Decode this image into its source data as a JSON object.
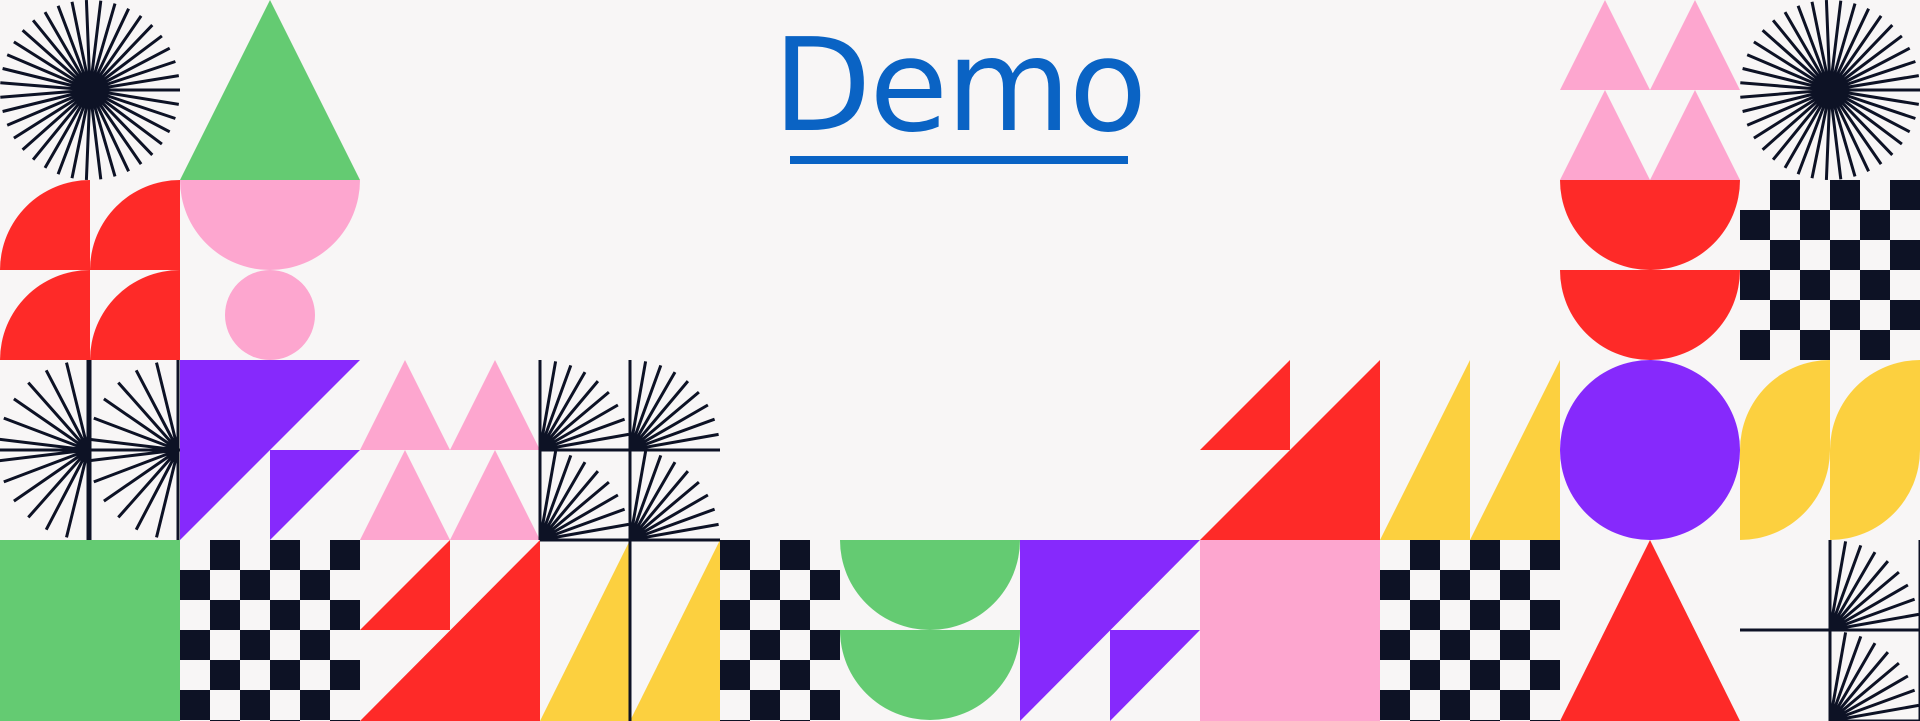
{
  "slide": {
    "title": "Demo"
  },
  "colors": {
    "background": "#f8f6f6",
    "title": "#0a63c4",
    "green": "#64cb72",
    "pink": "#fda6cf",
    "red": "#fe2a28",
    "purple": "#8629fc",
    "yellow": "#fcd03f",
    "navy": "#0d1225"
  },
  "decoration": {
    "style": "geometric pattern border",
    "motifs": [
      "starburst-icon",
      "triangle",
      "semicircle",
      "circle",
      "quarter-circle",
      "checkerboard",
      "square"
    ]
  }
}
